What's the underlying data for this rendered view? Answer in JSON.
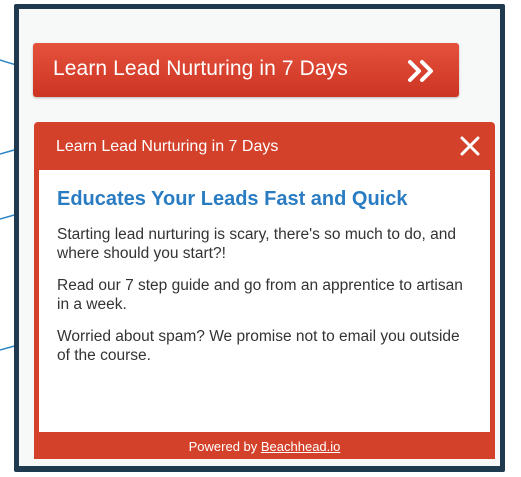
{
  "cta": {
    "label": "Learn Lead Nurturing in 7 Days",
    "icon": "double-chevron-right"
  },
  "widget": {
    "title": "Learn Lead Nurturing in 7 Days",
    "close_icon": "close-x",
    "heading": "Educates Your Leads Fast and Quick",
    "paragraphs": [
      "Starting lead nurturing is scary, there's so much to do, and where should you start?!",
      "Read our 7 step guide and go from an apprentice to artisan in a week.",
      "Worried about spam? We promise not to email you outside of the course."
    ],
    "footer": {
      "prefix": "Powered by ",
      "link": "Beachhead.io"
    }
  },
  "colors": {
    "accent_red": "#d4412b",
    "heading_blue": "#2a7cc2",
    "frame_navy": "#1f3a4f",
    "arrow_blue": "#2e86c8"
  }
}
